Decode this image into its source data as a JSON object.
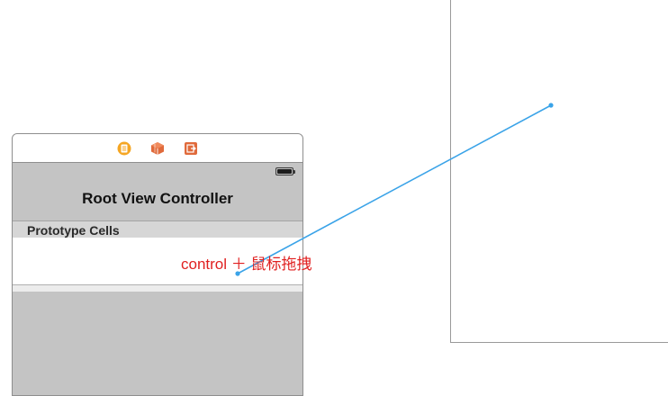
{
  "scene": {
    "dock_icons": [
      "view-controller-icon",
      "first-responder-icon",
      "exit-icon"
    ],
    "nav_title": "Root View Controller",
    "section_header": "Prototype Cells"
  },
  "annotation": {
    "text": "control ＋ 鼠标拖拽",
    "color": "#e02020"
  },
  "connection": {
    "color": "#3aa3e8"
  },
  "colors": {
    "dock_vc": "#f5a623",
    "dock_responder": "#e06a3b",
    "dock_exit": "#e06a3b"
  }
}
